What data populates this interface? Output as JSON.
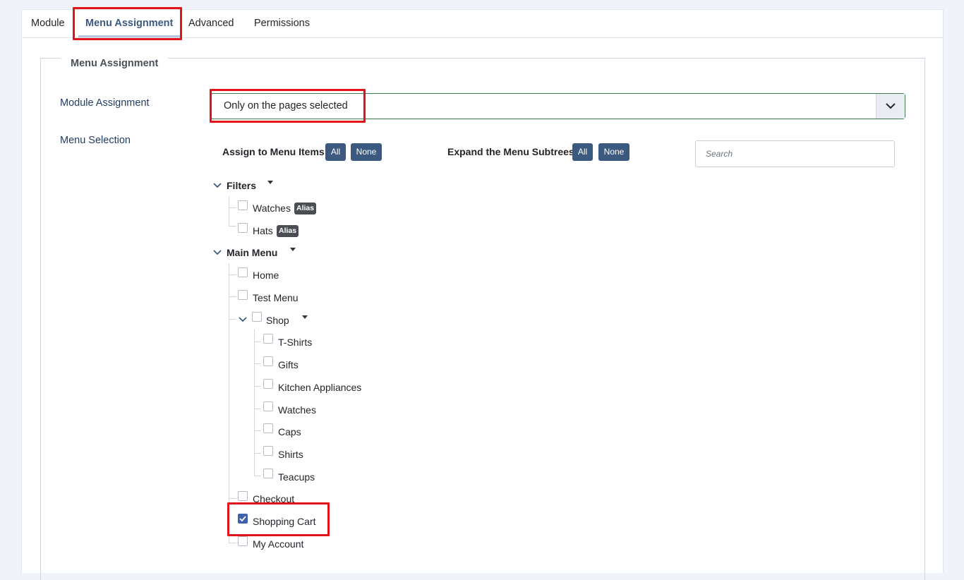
{
  "tabs": [
    "Module",
    "Menu Assignment",
    "Advanced",
    "Permissions"
  ],
  "fieldset": {
    "legend": "Menu Assignment",
    "module_assignment_label": "Module Assignment",
    "menu_selection_label": "Menu Selection",
    "module_assignment_value": "Only on the pages selected"
  },
  "controls": {
    "assign_label": "Assign to Menu Items",
    "expand_label": "Expand the Menu Subtrees",
    "all": "All",
    "none": "None",
    "search_placeholder": "Search"
  },
  "tree": {
    "filters": {
      "title": "Filters",
      "items": [
        "Watches",
        "Hats"
      ],
      "alias_badge": "Alias"
    },
    "main_menu": {
      "title": "Main Menu",
      "home": "Home",
      "test_menu": "Test Menu",
      "shop": {
        "title": "Shop",
        "children": [
          "T-Shirts",
          "Gifts",
          "Kitchen Appliances",
          "Watches",
          "Caps",
          "Shirts",
          "Teacups"
        ]
      },
      "checkout": "Checkout",
      "shopping_cart": "Shopping Cart",
      "my_account": "My Account"
    }
  },
  "state": {
    "shopping_cart_checked": true
  },
  "colors": {
    "accent": "#3c5a80",
    "highlight": "#e3131b",
    "checked": "#3d62a8"
  }
}
